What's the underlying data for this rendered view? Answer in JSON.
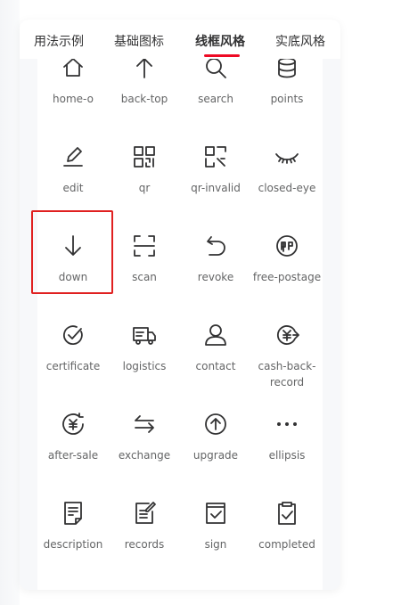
{
  "tabs": [
    {
      "label": "用法示例"
    },
    {
      "label": "基础图标"
    },
    {
      "label": "线框风格"
    },
    {
      "label": "实底风格"
    }
  ],
  "colors": {
    "accent": "#ee0a24",
    "icon": "#323233",
    "label": "#646566",
    "highlight": "#e02020"
  },
  "icons": [
    {
      "label": "home-o",
      "icon": "home-icon"
    },
    {
      "label": "back-top",
      "icon": "back-top-icon"
    },
    {
      "label": "search",
      "icon": "search-icon"
    },
    {
      "label": "points",
      "icon": "points-icon"
    },
    {
      "label": "edit",
      "icon": "edit-icon"
    },
    {
      "label": "qr",
      "icon": "qr-icon"
    },
    {
      "label": "qr-invalid",
      "icon": "qr-invalid-icon"
    },
    {
      "label": "closed-eye",
      "icon": "closed-eye-icon"
    },
    {
      "label": "down",
      "icon": "down-icon"
    },
    {
      "label": "scan",
      "icon": "scan-icon"
    },
    {
      "label": "revoke",
      "icon": "revoke-icon"
    },
    {
      "label": "free-postage",
      "icon": "free-postage-icon"
    },
    {
      "label": "certificate",
      "icon": "certificate-icon"
    },
    {
      "label": "logistics",
      "icon": "logistics-icon"
    },
    {
      "label": "contact",
      "icon": "contact-icon"
    },
    {
      "label": "cash-back-record",
      "icon": "cash-back-record-icon"
    },
    {
      "label": "after-sale",
      "icon": "after-sale-icon"
    },
    {
      "label": "exchange",
      "icon": "exchange-icon"
    },
    {
      "label": "upgrade",
      "icon": "upgrade-icon"
    },
    {
      "label": "ellipsis",
      "icon": "ellipsis-icon"
    },
    {
      "label": "description",
      "icon": "description-icon"
    },
    {
      "label": "records",
      "icon": "records-icon"
    },
    {
      "label": "sign",
      "icon": "sign-icon"
    },
    {
      "label": "completed",
      "icon": "completed-icon"
    }
  ]
}
